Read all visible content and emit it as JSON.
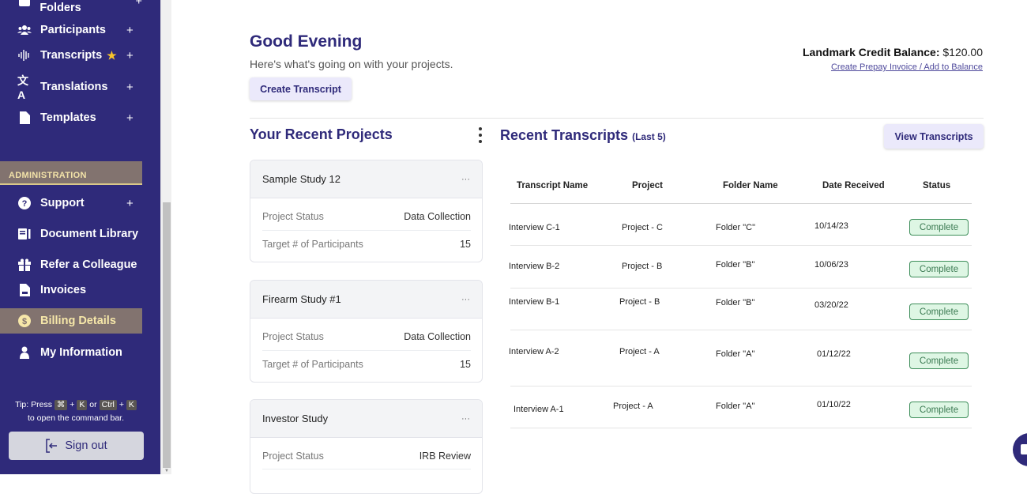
{
  "sidebar": {
    "partial_item": "Research Folders",
    "items": [
      {
        "label": "Participants",
        "icon": "users-icon",
        "plus": "+"
      },
      {
        "label": "Transcripts",
        "icon": "waveform-icon",
        "plus": "+"
      },
      {
        "label": "Translations",
        "icon": "translate-icon",
        "plus": "+"
      },
      {
        "label": "Templates",
        "icon": "file-icon",
        "plus": "+"
      }
    ],
    "admin_header": "ADMINISTRATION",
    "admin_items": [
      {
        "label": "Support",
        "icon": "question-circle-icon",
        "plus": "+"
      },
      {
        "label": "Document Library",
        "icon": "book-icon"
      },
      {
        "label": "Refer a Colleague",
        "icon": "gift-icon"
      },
      {
        "label": "Invoices",
        "icon": "invoice-icon"
      },
      {
        "label": "Billing Details",
        "icon": "dollar-circle-icon",
        "active": true
      },
      {
        "label": "My Information",
        "icon": "user-icon"
      }
    ],
    "tip": {
      "prefix": "Tip: Press",
      "key_cmd": "⌘",
      "plus": "+",
      "key_k": "K",
      "or": "or",
      "key_ctrl": "Ctrl",
      "suffix": "to open the command bar."
    },
    "sign_out": "Sign out"
  },
  "header": {
    "greeting": "Good Evening",
    "subtitle": "Here's what's going on with your projects.",
    "create_button": "Create Transcript",
    "credit_label": "Landmark Credit Balance:",
    "credit_value": "$120.00",
    "credit_link": "Create Prepay Invoice / Add to Balance"
  },
  "projects": {
    "title": "Your Recent Projects",
    "cards": [
      {
        "name": "Sample Study 12",
        "rows": [
          {
            "label": "Project Status",
            "value": "Data Collection"
          },
          {
            "label": "Target # of Participants",
            "value": "15"
          }
        ]
      },
      {
        "name": "Firearm Study #1",
        "rows": [
          {
            "label": "Project Status",
            "value": "Data Collection"
          },
          {
            "label": "Target # of Participants",
            "value": "15"
          }
        ]
      },
      {
        "name": "Investor Study",
        "rows": [
          {
            "label": "Project Status",
            "value": "IRB Review"
          }
        ]
      }
    ],
    "card_menu": "···"
  },
  "transcripts": {
    "title": "Recent Transcripts",
    "subtitle": "(Last 5)",
    "view_button": "View Transcripts",
    "columns": [
      "Transcript Name",
      "Project",
      "Folder Name",
      "Date Received",
      "Status"
    ],
    "rows": [
      {
        "name": "Interview C-1",
        "project": "Project - C",
        "folder": "Folder \"C\"",
        "date": "10/14/23",
        "status": "Complete"
      },
      {
        "name": "Interview B-2",
        "project": "Project - B",
        "folder": "Folder \"B\"",
        "date": "10/06/23",
        "status": "Complete"
      },
      {
        "name": "Interview B-1",
        "project": "Project - B",
        "folder": "Folder \"B\"",
        "date": "03/20/22",
        "status": "Complete"
      },
      {
        "name": "Interview A-2",
        "project": "Project - A",
        "folder": "Folder \"A\"",
        "date": "01/12/22",
        "status": "Complete"
      },
      {
        "name": "Interview A-1",
        "project": "Project - A",
        "folder": "Folder \"A\"",
        "date": "01/10/22",
        "status": "Complete"
      }
    ]
  },
  "colors": {
    "brand": "#2f2a7a",
    "active": "#82736f",
    "status_complete": "#def6e4"
  }
}
